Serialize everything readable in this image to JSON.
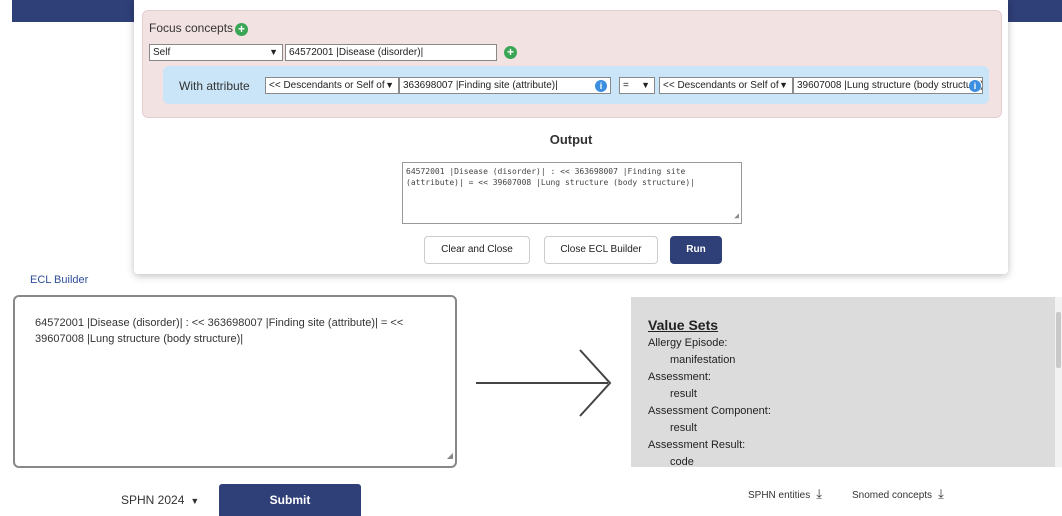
{
  "modal": {
    "focus_label": "Focus concepts",
    "self_option": "Self",
    "focus_concept": "64572001 |Disease (disorder)|",
    "with_attribute_label": "With attribute",
    "attr_operator": "<< Descendants or Self of",
    "attribute_concept": "363698007 |Finding site (attribute)|",
    "eq_operator": "=",
    "value_operator": "<< Descendants or Self of",
    "value_concept": "39607008 |Lung structure (body structure)|",
    "output_title": "Output",
    "output_text": "64572001 |Disease (disorder)| : << 363698007 |Finding site (attribute)| = << 39607008 |Lung structure (body structure)|",
    "buttons": {
      "clear_close": "Clear and Close",
      "close_builder": "Close ECL Builder",
      "run": "Run"
    }
  },
  "ecl_builder_label": "ECL Builder",
  "query_text": "64572001 |Disease (disorder)| : << 363698007 |Finding site (attribute)| = << 39607008 |Lung structure (body structure)|",
  "value_sets": {
    "title": "Value Sets",
    "items": [
      {
        "name": "Allergy Episode:",
        "sub": "manifestation"
      },
      {
        "name": "Assessment:",
        "sub": "result"
      },
      {
        "name": "Assessment Component:",
        "sub": "result"
      },
      {
        "name": "Assessment Result:",
        "sub": "code"
      }
    ]
  },
  "footer": {
    "version": "SPHN 2024",
    "submit": "Submit",
    "sphn_entities": "SPHN entities",
    "snomed_concepts": "Snomed concepts"
  },
  "colors": {
    "brand": "#2f3f78",
    "add": "#3aa655",
    "info": "#3b8fde"
  }
}
